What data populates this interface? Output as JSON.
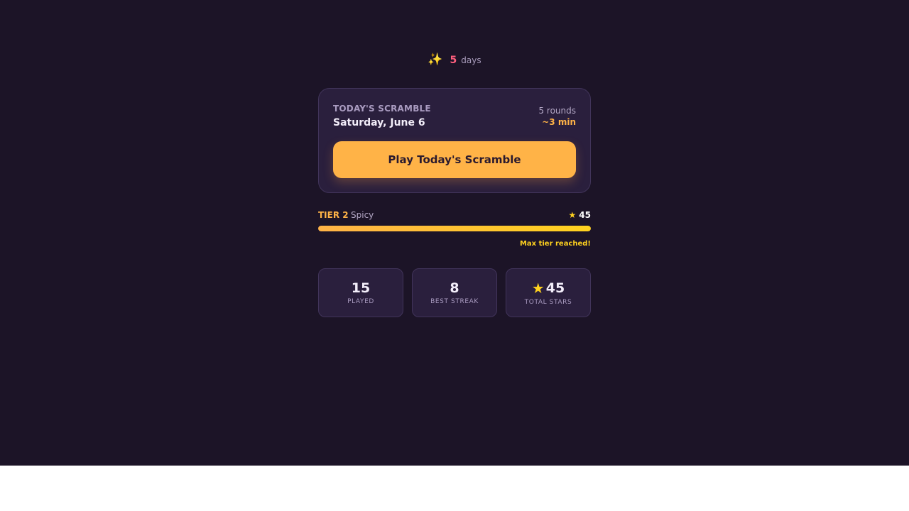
{
  "streak": {
    "icon": "sparkles-icon",
    "count": "5",
    "unit": "days"
  },
  "scramble": {
    "label": "TODAY'S SCRAMBLE",
    "date": "Saturday, June 6",
    "rounds": "5 rounds",
    "time": "~3 min",
    "play_label": "Play Today's Scramble"
  },
  "tier": {
    "name": "TIER 2",
    "subtitle": "Spicy",
    "stars": "45",
    "progress_percent": 100,
    "note": "Max tier reached!"
  },
  "stats": {
    "played": {
      "value": "15",
      "label": "PLAYED"
    },
    "best_streak": {
      "value": "8",
      "label": "BEST STREAK"
    },
    "total_stars": {
      "value": "45",
      "label": "TOTAL STARS"
    }
  },
  "colors": {
    "background": "#1c1427",
    "card": "#2a1f3d",
    "accent_orange": "#ffb347",
    "accent_yellow": "#ffd21f",
    "streak_red": "#ff5f7e"
  }
}
